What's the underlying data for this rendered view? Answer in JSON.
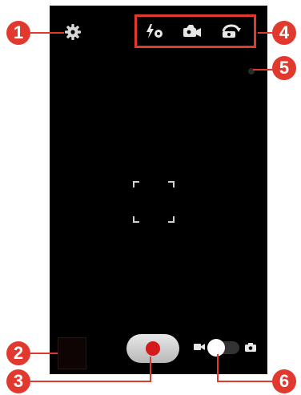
{
  "icons": {
    "settings": "gear-icon",
    "flash": "flash-auto-icon",
    "camera_switch": "camera-switch-icon",
    "recording_mode": "recording-mode-icon",
    "video_mode": "video-camera-icon",
    "photo_mode": "camera-icon"
  },
  "colors": {
    "screen": "#000000",
    "callout": "#e2392f",
    "record": "#d41a1a"
  },
  "callouts": {
    "c1": "1",
    "c2": "2",
    "c3": "3",
    "c4": "4",
    "c5": "5",
    "c6": "6"
  }
}
